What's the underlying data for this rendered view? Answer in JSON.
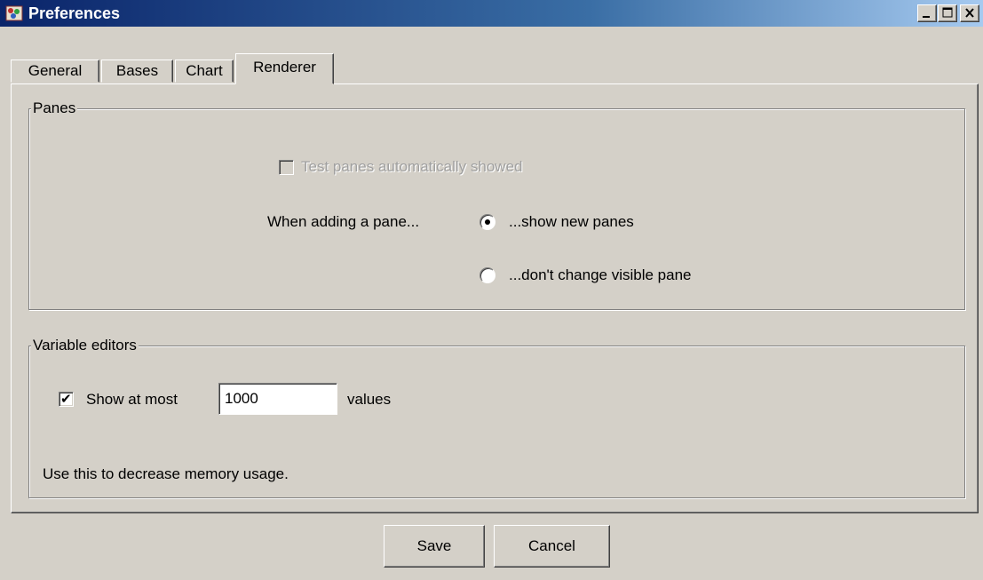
{
  "window": {
    "title": "Preferences"
  },
  "tabs": [
    {
      "label": "General",
      "active": false
    },
    {
      "label": "Bases",
      "active": false
    },
    {
      "label": "Chart",
      "active": false
    },
    {
      "label": "Renderer",
      "active": true
    }
  ],
  "panes_group": {
    "legend": "Panes",
    "test_panes_checkbox": {
      "label": "Test panes automatically showed",
      "checked": false,
      "enabled": false
    },
    "adding_pane_label": "When adding a pane...",
    "options": [
      {
        "label": "...show new panes",
        "selected": true
      },
      {
        "label": "...don't change visible pane",
        "selected": false
      }
    ]
  },
  "variable_editors": {
    "legend": "Variable editors",
    "show_at_most": {
      "label": "Show at most",
      "checked": true
    },
    "limit_value": "1000",
    "values_label": "values",
    "hint": "Use this to decrease memory usage."
  },
  "buttons": {
    "save": "Save",
    "cancel": "Cancel"
  },
  "colors": {
    "title_start": "#0a246a",
    "title_end": "#a6caf0",
    "face": "#d4d0c8"
  }
}
